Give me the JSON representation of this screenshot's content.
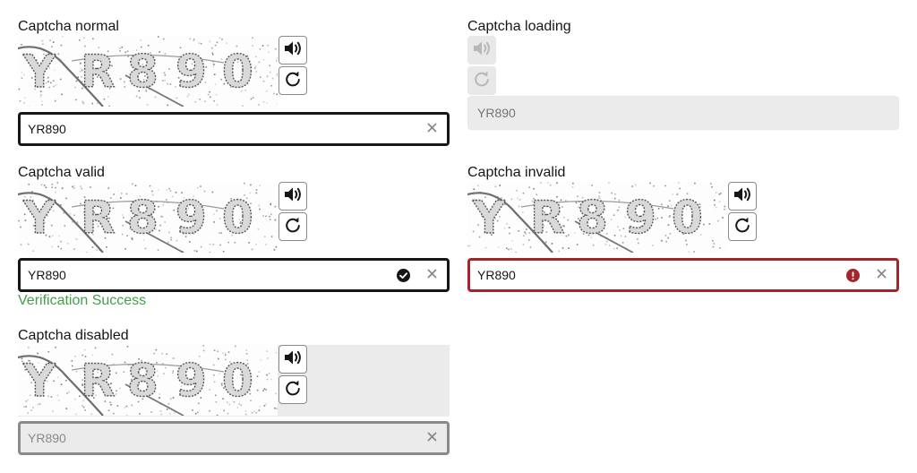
{
  "captchas": {
    "normal": {
      "title": "Captcha normal",
      "value": "YR890"
    },
    "loading": {
      "title": "Captcha loading",
      "placeholder": "YR890"
    },
    "valid": {
      "title": "Captcha valid",
      "value": "YR890",
      "message": "Verification Success"
    },
    "invalid": {
      "title": "Captcha invalid",
      "value": "YR890"
    },
    "disabled": {
      "title": "Captcha disabled",
      "value": "YR890"
    }
  },
  "captcha_text": "YR890",
  "icons": {
    "audio": "speaker-icon",
    "refresh": "refresh-icon",
    "clear": "close-icon",
    "valid": "check-circle-icon",
    "invalid": "error-circle-icon"
  },
  "colors": {
    "border": "#161616",
    "invalid": "#a4262c",
    "success": "#43a047",
    "disabled_bg": "#ebebeb"
  }
}
